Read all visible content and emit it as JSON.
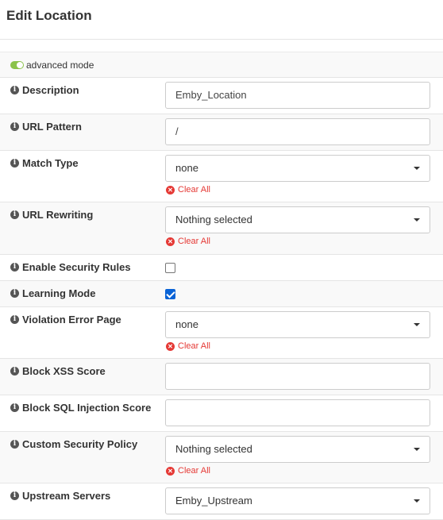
{
  "header": {
    "title": "Edit Location"
  },
  "advanced_mode": {
    "label": "advanced mode"
  },
  "fields": {
    "description": {
      "label": "Description",
      "value": "Emby_Location"
    },
    "url_pattern": {
      "label": "URL Pattern",
      "value": "/"
    },
    "match_type": {
      "label": "Match Type",
      "value": "none",
      "clear": "Clear All"
    },
    "url_rewriting": {
      "label": "URL Rewriting",
      "value": "Nothing selected",
      "clear": "Clear All"
    },
    "enable_security_rules": {
      "label": "Enable Security Rules",
      "checked": false
    },
    "learning_mode": {
      "label": "Learning Mode",
      "checked": true
    },
    "violation_error_page": {
      "label": "Violation Error Page",
      "value": "none",
      "clear": "Clear All"
    },
    "block_xss_score": {
      "label": "Block XSS Score",
      "value": ""
    },
    "block_sql_injection_score": {
      "label": "Block SQL Injection Score",
      "value": ""
    },
    "custom_security_policy": {
      "label": "Custom Security Policy",
      "value": "Nothing selected",
      "clear": "Clear All"
    },
    "upstream_servers": {
      "label": "Upstream Servers",
      "value": "Emby_Upstream"
    }
  },
  "icons": {
    "info": "info-circle-icon",
    "clear": "times-circle-icon",
    "dropdown": "caret-down-icon"
  },
  "colors": {
    "toggle_on": "#8bc34a",
    "clear_red": "#e53935",
    "checkbox_blue": "#0a63d6"
  }
}
